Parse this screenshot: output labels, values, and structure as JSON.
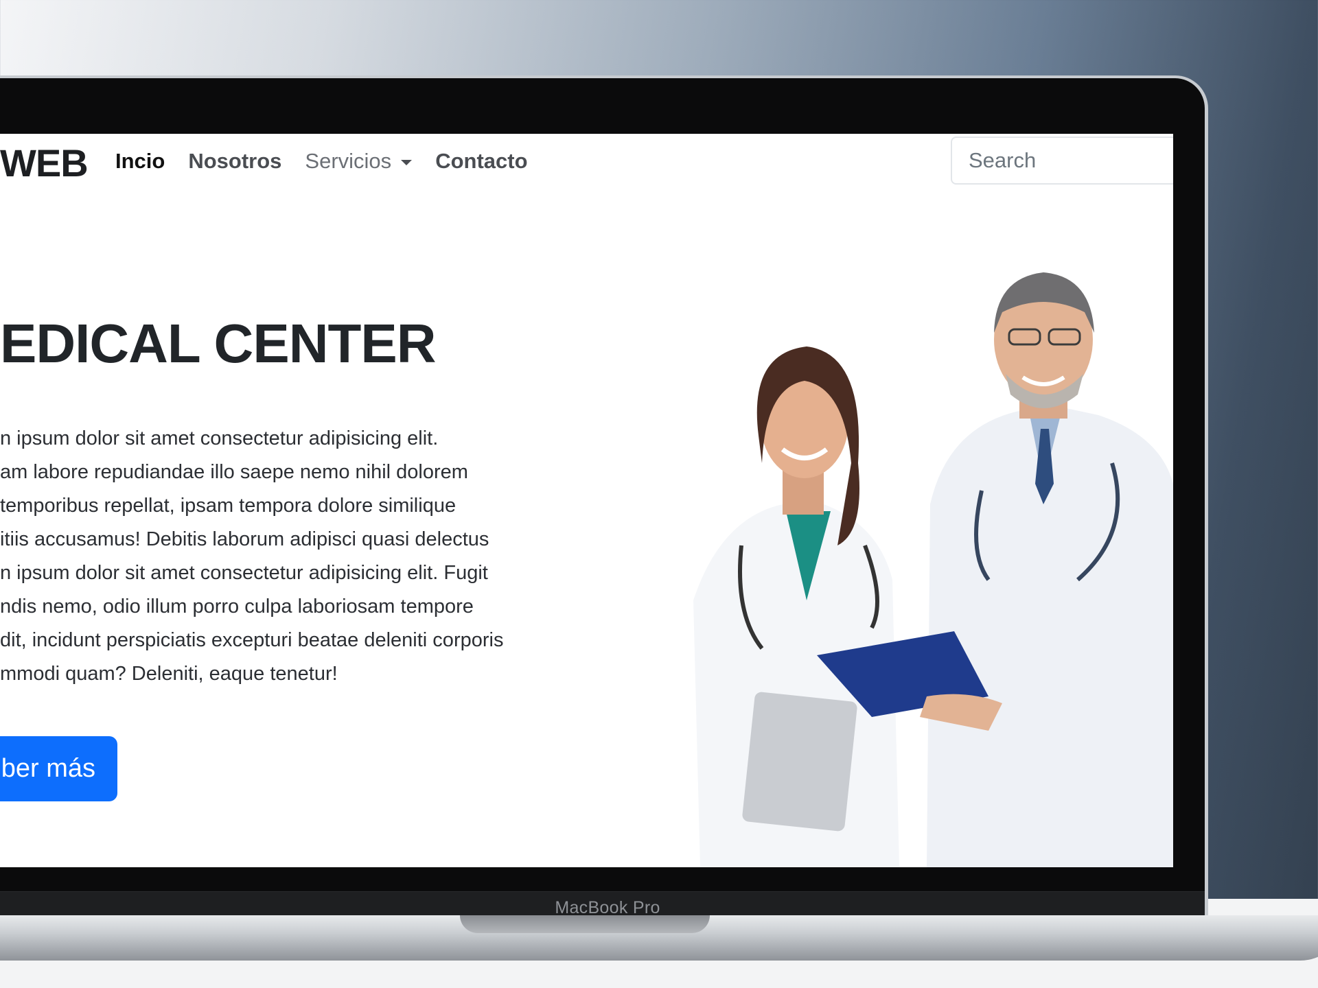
{
  "device": {
    "model_label": "MacBook Pro"
  },
  "navbar": {
    "brand": "WEB",
    "links": [
      {
        "label": "Incio",
        "active": true
      },
      {
        "label": "Nosotros"
      },
      {
        "label": "Servicios",
        "dropdown": true
      },
      {
        "label": "Contacto"
      }
    ],
    "search_placeholder": "Search"
  },
  "hero": {
    "title": "EDICAL CENTER",
    "paragraph_lines": [
      "n ipsum dolor sit amet consectetur adipisicing elit.",
      "am labore repudiandae illo saepe nemo nihil dolorem",
      "temporibus repellat, ipsam tempora dolore similique",
      "itiis accusamus! Debitis laborum adipisci quasi delectus",
      "n ipsum dolor sit amet consectetur adipisicing elit. Fugit",
      "ndis nemo, odio illum porro culpa laboriosam tempore",
      "dit, incidunt perspiciatis excepturi beatae deleniti corporis",
      "mmodi quam? Deleniti, eaque tenetur!"
    ],
    "button_label": "ber más",
    "image": "doctors-photo"
  },
  "colors": {
    "primary": "#0d6efd",
    "text": "#212529",
    "bezel": "#0b0b0c"
  }
}
